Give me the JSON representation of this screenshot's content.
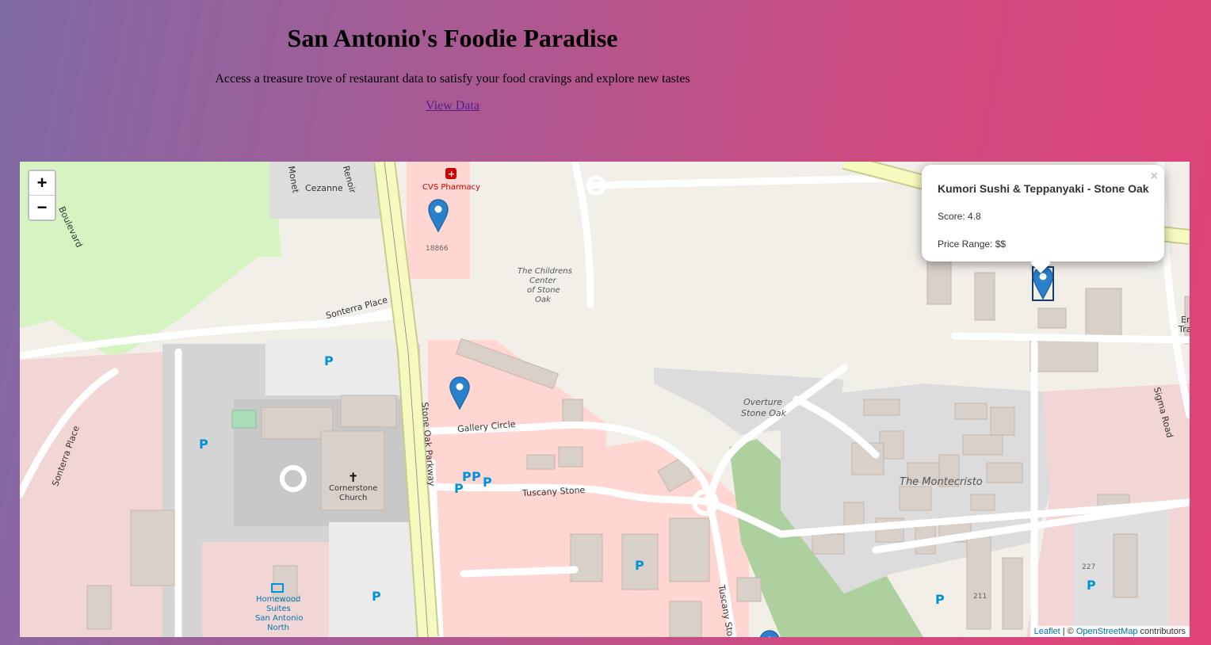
{
  "header": {
    "title": "San Antonio's Foodie Paradise",
    "subtitle": "Access a treasure trove of restaurant data to satisfy your food cravings and explore new tastes",
    "link_label": "View Data"
  },
  "map": {
    "zoom_in": "+",
    "zoom_out": "−",
    "labels": {
      "cvs": "CVS Pharmacy",
      "cezanne": "Cezanne",
      "monet": "Monet",
      "renoir": "Renoir",
      "boulevard": "Boulevard",
      "num_18866": "18866",
      "childrens_1": "The Childrens",
      "childrens_2": "Center",
      "childrens_3": "of Stone",
      "childrens_4": "Oak",
      "sonterra_place_1": "Sonterra Place",
      "sonterra_place_2": "Sonterra Place",
      "stone_oak_parkway": "Stone Oak Parkway",
      "gallery_circle": "Gallery Circle",
      "tuscany_stone": "Tuscany Stone",
      "tuscany_stone_2": "Tuscany Sto",
      "overture_1": "Overture",
      "overture_2": "Stone Oak",
      "montecristo": "The Montecristo",
      "sigma_road": "Sigma Road",
      "cornerstone_1": "Cornerstone",
      "cornerstone_2": "Church",
      "homewood_1": "Homewood",
      "homewood_2": "Suites",
      "homewood_3": "San Antonio",
      "homewood_4": "North",
      "num_211": "211",
      "num_227": "227",
      "en_1": "En",
      "en_2": "Tra"
    },
    "popup": {
      "name": "Kumori Sushi & Teppanyaki - Stone Oak",
      "score": "Score: 4.8",
      "price": "Price Range: $$",
      "close": "×"
    },
    "attribution": {
      "leaflet": "Leaflet",
      "separator": " | © ",
      "osm": "OpenStreetMap",
      "contributors": " contributors"
    },
    "colors": {
      "land": "#f2efe9",
      "commercial": "#f2d5d5",
      "retail": "#ffd6d1",
      "parking": "#e0dfdf",
      "building": "#d9d0c9",
      "park": "#d6f3c2",
      "wood": "#add19e",
      "primary_road": "#f7fabf",
      "marker": "#2a81cb"
    }
  }
}
